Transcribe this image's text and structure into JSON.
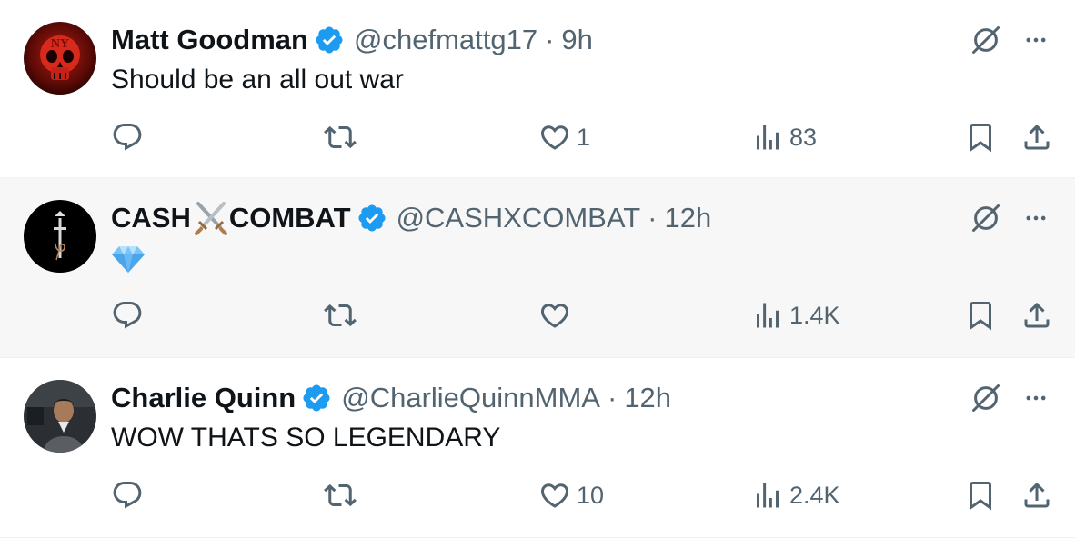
{
  "tweets": [
    {
      "name": "Matt Goodman",
      "handle": "@chefmattg17",
      "separator": "·",
      "time": "9h",
      "text": "Should be an all out war",
      "likes": "1",
      "views": "83",
      "avatar_icon": "red-skull-avatar"
    },
    {
      "name_part1": "CASH",
      "name_part2": "COMBAT",
      "name_emoji": "crossed-swords-icon",
      "handle": "@CASHXCOMBAT",
      "separator": "·",
      "time": "12h",
      "text_emoji": "gem-stone-icon",
      "likes": "",
      "views": "1.4K",
      "avatar_icon": "cash-combat-logo-avatar"
    },
    {
      "name": "Charlie Quinn",
      "handle": "@CharlieQuinnMMA",
      "separator": "·",
      "time": "12h",
      "text": "WOW THATS SO LEGENDARY",
      "likes": "10",
      "views": "2.4K",
      "avatar_icon": "person-photo-avatar"
    }
  ],
  "colors": {
    "verified": "#1d9bf0",
    "secondary_text": "#536471",
    "hover_bg": "#f7f7f7"
  }
}
